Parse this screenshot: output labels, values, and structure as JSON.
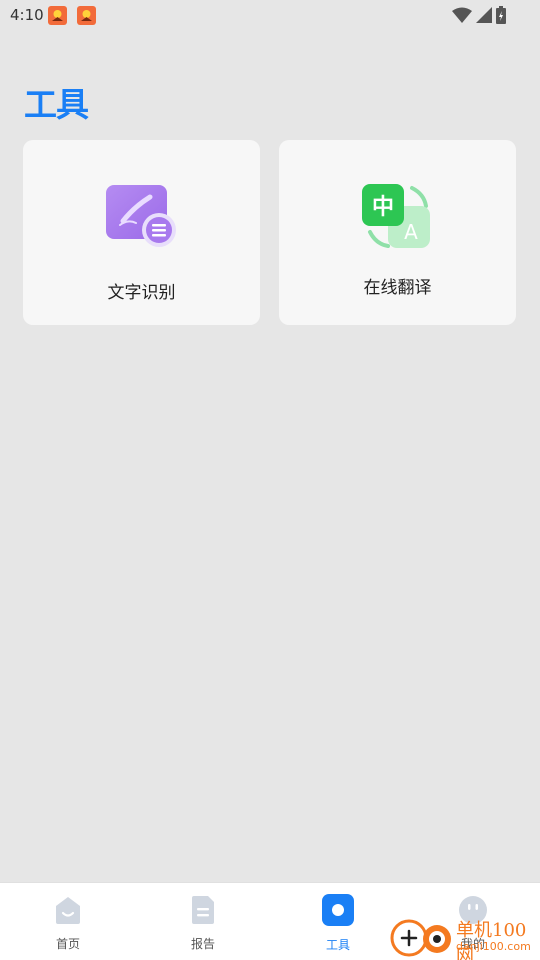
{
  "status_bar": {
    "time": "4:10",
    "notification_icons": [
      "app-notification-icon",
      "app-notification-icon"
    ],
    "system_icons": [
      "wifi-icon",
      "signal-icon",
      "battery-icon"
    ]
  },
  "page": {
    "title": "工具"
  },
  "tools": [
    {
      "label": "文字识别",
      "icon": "text-recognition-icon"
    },
    {
      "label": "在线翻译",
      "icon": "translate-icon",
      "icon_text_zh": "中",
      "icon_text_en": "A"
    }
  ],
  "bottom_nav": {
    "items": [
      {
        "label": "首页",
        "icon": "home-icon",
        "active": false
      },
      {
        "label": "报告",
        "icon": "report-icon",
        "active": false
      },
      {
        "label": "工具",
        "icon": "tools-icon",
        "active": true
      },
      {
        "label": "我的",
        "icon": "profile-icon",
        "active": false
      }
    ]
  },
  "watermark": {
    "line1": "单机100网",
    "line2": "danji100.com"
  },
  "colors": {
    "accent": "#1a7ff5",
    "background": "#e6e6e6",
    "card": "#f7f7f7",
    "ocr_purple": "#a878ee",
    "translate_green": "#2dc653",
    "watermark_orange": "#f47a20"
  }
}
